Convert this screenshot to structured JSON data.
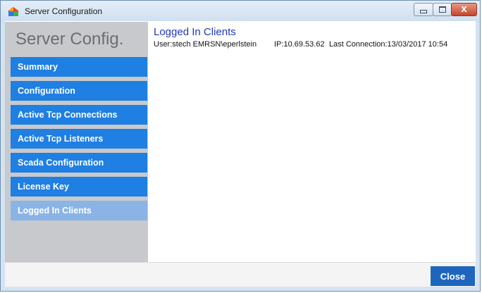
{
  "window": {
    "title": "Server Configuration",
    "controls": {
      "minimize": "–",
      "maximize": "□",
      "close": "X"
    }
  },
  "sidebar": {
    "title": "Server Config.",
    "items": [
      {
        "label": "Summary",
        "active": false
      },
      {
        "label": "Configuration",
        "active": false
      },
      {
        "label": "Active Tcp Connections",
        "active": false
      },
      {
        "label": "Active Tcp Listeners",
        "active": false
      },
      {
        "label": "Scada Configuration",
        "active": false
      },
      {
        "label": "License Key",
        "active": false
      },
      {
        "label": "Logged In Clients",
        "active": true
      }
    ]
  },
  "main": {
    "title": "Logged In Clients",
    "clients": [
      {
        "user": "User:stech EMRSN\\eperlstein",
        "ip": "IP:10.69.53.62",
        "last_connection": "Last Connection:13/03/2017 10:54"
      }
    ]
  },
  "footer": {
    "close_label": "Close"
  },
  "colors": {
    "nav_blue": "#1f7fe2",
    "nav_active": "#8ab4e6",
    "sidebar_bg": "#c8c9cc",
    "title_blue": "#1f38b8",
    "close_button": "#1e66bd"
  }
}
